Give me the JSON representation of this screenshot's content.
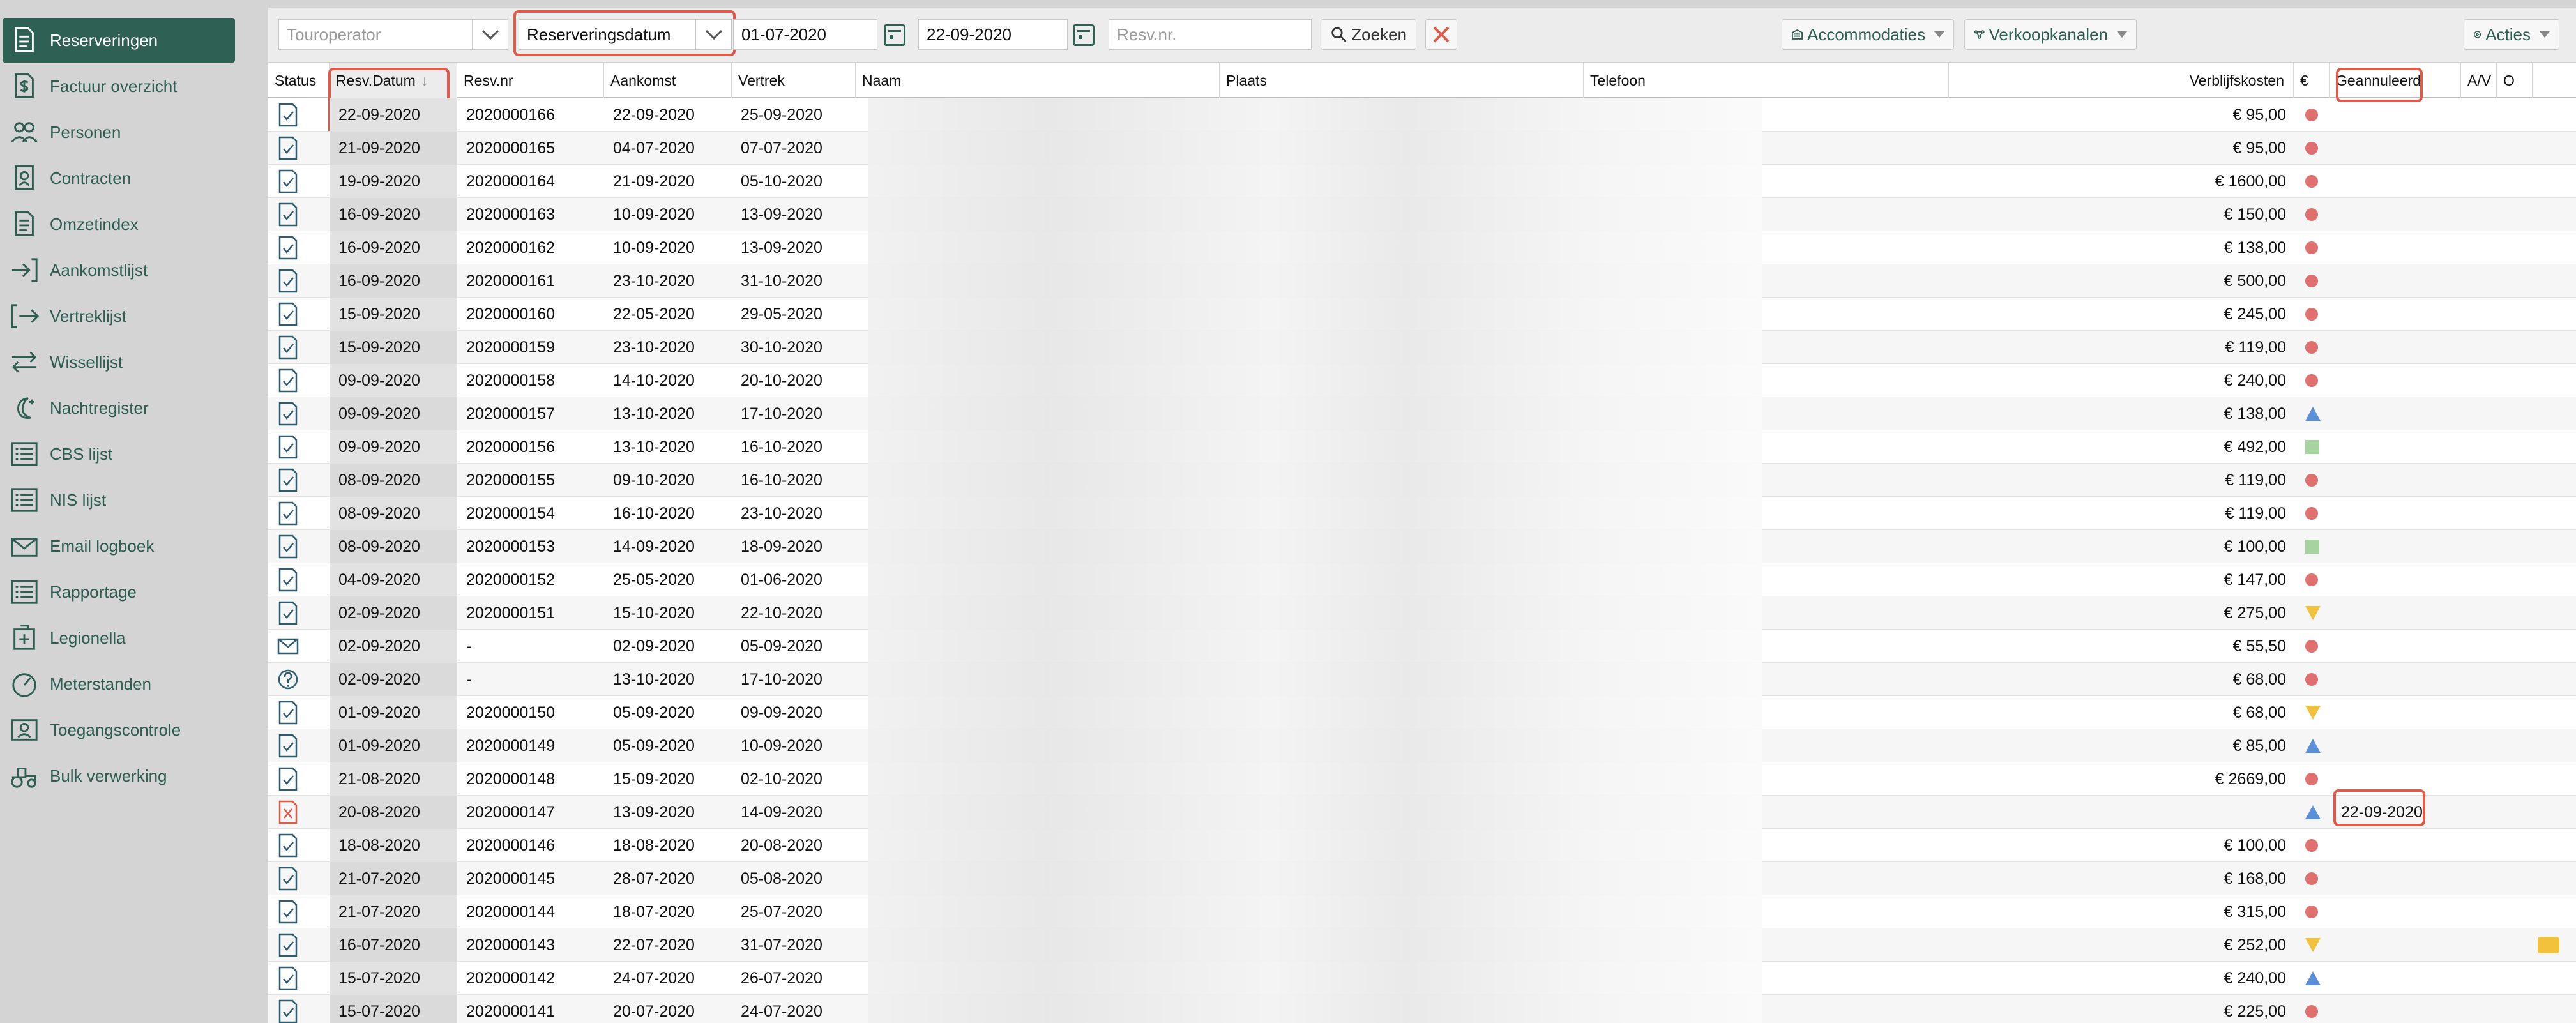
{
  "sidebar": {
    "items": [
      {
        "label": "Reserveringen",
        "icon": "document-icon",
        "active": true
      },
      {
        "label": "Factuur overzicht",
        "icon": "invoice-icon"
      },
      {
        "label": "Personen",
        "icon": "people-icon"
      },
      {
        "label": "Contracten",
        "icon": "contract-icon"
      },
      {
        "label": "Omzetindex",
        "icon": "document-icon"
      },
      {
        "label": "Aankomstlijst",
        "icon": "arrival-icon"
      },
      {
        "label": "Vertreklijst",
        "icon": "departure-icon"
      },
      {
        "label": "Wissellijst",
        "icon": "swap-icon"
      },
      {
        "label": "Nachtregister",
        "icon": "moon-icon"
      },
      {
        "label": "CBS lijst",
        "icon": "list-icon"
      },
      {
        "label": "NIS lijst",
        "icon": "list-icon"
      },
      {
        "label": "Email logboek",
        "icon": "email-icon"
      },
      {
        "label": "Rapportage",
        "icon": "list-icon"
      },
      {
        "label": "Legionella",
        "icon": "medical-icon"
      },
      {
        "label": "Meterstanden",
        "icon": "gauge-icon"
      },
      {
        "label": "Toegangscontrole",
        "icon": "access-icon"
      },
      {
        "label": "Bulk verwerking",
        "icon": "tractor-icon"
      }
    ]
  },
  "toolbar": {
    "touroperator_placeholder": "Touroperator",
    "date_type": "Reserveringsdatum",
    "date_from": "01-07-2020",
    "date_to": "22-09-2020",
    "resv_placeholder": "Resv.nr.",
    "search_label": "Zoeken",
    "accommodaties_label": "Accommodaties",
    "verkoopkanalen_label": "Verkoopkanalen",
    "acties_label": "Acties"
  },
  "columns": {
    "status": "Status",
    "resv_datum": "Resv.Datum",
    "resv_nr": "Resv.nr",
    "aankomst": "Aankomst",
    "vertrek": "Vertrek",
    "naam": "Naam",
    "plaats": "Plaats",
    "telefoon": "Telefoon",
    "verblijfskosten": "Verblijfskosten",
    "euro": "€",
    "geannuleerd": "Geannuleerd",
    "av": "A/V",
    "o": "O"
  },
  "rows": [
    {
      "status": "check",
      "resv_datum": "22-09-2020",
      "resv_nr": "2020000166",
      "aankomst": "22-09-2020",
      "vertrek": "25-09-2020",
      "kosten": "€ 95,00",
      "pay": "dot",
      "geannuleerd": ""
    },
    {
      "status": "check",
      "resv_datum": "21-09-2020",
      "resv_nr": "2020000165",
      "aankomst": "04-07-2020",
      "vertrek": "07-07-2020",
      "kosten": "€ 95,00",
      "pay": "dot",
      "geannuleerd": ""
    },
    {
      "status": "check",
      "resv_datum": "19-09-2020",
      "resv_nr": "2020000164",
      "aankomst": "21-09-2020",
      "vertrek": "05-10-2020",
      "kosten": "€ 1600,00",
      "pay": "dot",
      "geannuleerd": ""
    },
    {
      "status": "check",
      "resv_datum": "16-09-2020",
      "resv_nr": "2020000163",
      "aankomst": "10-09-2020",
      "vertrek": "13-09-2020",
      "kosten": "€ 150,00",
      "pay": "dot",
      "geannuleerd": ""
    },
    {
      "status": "check",
      "resv_datum": "16-09-2020",
      "resv_nr": "2020000162",
      "aankomst": "10-09-2020",
      "vertrek": "13-09-2020",
      "kosten": "€ 138,00",
      "pay": "dot",
      "geannuleerd": ""
    },
    {
      "status": "check",
      "resv_datum": "16-09-2020",
      "resv_nr": "2020000161",
      "aankomst": "23-10-2020",
      "vertrek": "31-10-2020",
      "kosten": "€ 500,00",
      "pay": "dot",
      "geannuleerd": ""
    },
    {
      "status": "check",
      "resv_datum": "15-09-2020",
      "resv_nr": "2020000160",
      "aankomst": "22-05-2020",
      "vertrek": "29-05-2020",
      "kosten": "€ 245,00",
      "pay": "dot",
      "geannuleerd": ""
    },
    {
      "status": "check",
      "resv_datum": "15-09-2020",
      "resv_nr": "2020000159",
      "aankomst": "23-10-2020",
      "vertrek": "30-10-2020",
      "kosten": "€ 119,00",
      "pay": "dot",
      "geannuleerd": ""
    },
    {
      "status": "check",
      "resv_datum": "09-09-2020",
      "resv_nr": "2020000158",
      "aankomst": "14-10-2020",
      "vertrek": "20-10-2020",
      "kosten": "€ 240,00",
      "pay": "dot",
      "geannuleerd": ""
    },
    {
      "status": "check",
      "resv_datum": "09-09-2020",
      "resv_nr": "2020000157",
      "aankomst": "13-10-2020",
      "vertrek": "17-10-2020",
      "kosten": "€ 138,00",
      "pay": "tri-up",
      "geannuleerd": ""
    },
    {
      "status": "check",
      "resv_datum": "09-09-2020",
      "resv_nr": "2020000156",
      "aankomst": "13-10-2020",
      "vertrek": "16-10-2020",
      "kosten": "€ 492,00",
      "pay": "sq",
      "geannuleerd": ""
    },
    {
      "status": "check",
      "resv_datum": "08-09-2020",
      "resv_nr": "2020000155",
      "aankomst": "09-10-2020",
      "vertrek": "16-10-2020",
      "kosten": "€ 119,00",
      "pay": "dot",
      "geannuleerd": ""
    },
    {
      "status": "check",
      "resv_datum": "08-09-2020",
      "resv_nr": "2020000154",
      "aankomst": "16-10-2020",
      "vertrek": "23-10-2020",
      "kosten": "€ 119,00",
      "pay": "dot",
      "geannuleerd": ""
    },
    {
      "status": "check",
      "resv_datum": "08-09-2020",
      "resv_nr": "2020000153",
      "aankomst": "14-09-2020",
      "vertrek": "18-09-2020",
      "kosten": "€ 100,00",
      "pay": "sq",
      "geannuleerd": ""
    },
    {
      "status": "check",
      "resv_datum": "04-09-2020",
      "resv_nr": "2020000152",
      "aankomst": "25-05-2020",
      "vertrek": "01-06-2020",
      "kosten": "€ 147,00",
      "pay": "dot",
      "geannuleerd": ""
    },
    {
      "status": "check",
      "resv_datum": "02-09-2020",
      "resv_nr": "2020000151",
      "aankomst": "15-10-2020",
      "vertrek": "22-10-2020",
      "kosten": "€ 275,00",
      "pay": "tri-down",
      "geannuleerd": ""
    },
    {
      "status": "mail",
      "resv_datum": "02-09-2020",
      "resv_nr": "-",
      "aankomst": "02-09-2020",
      "vertrek": "05-09-2020",
      "kosten": "€ 55,50",
      "pay": "dot",
      "geannuleerd": ""
    },
    {
      "status": "question",
      "resv_datum": "02-09-2020",
      "resv_nr": "-",
      "aankomst": "13-10-2020",
      "vertrek": "17-10-2020",
      "kosten": "€ 68,00",
      "pay": "dot",
      "geannuleerd": ""
    },
    {
      "status": "check",
      "resv_datum": "01-09-2020",
      "resv_nr": "2020000150",
      "aankomst": "05-09-2020",
      "vertrek": "09-09-2020",
      "kosten": "€ 68,00",
      "pay": "tri-down",
      "geannuleerd": ""
    },
    {
      "status": "check",
      "resv_datum": "01-09-2020",
      "resv_nr": "2020000149",
      "aankomst": "05-09-2020",
      "vertrek": "10-09-2020",
      "kosten": "€ 85,00",
      "pay": "tri-up",
      "geannuleerd": ""
    },
    {
      "status": "check",
      "resv_datum": "21-08-2020",
      "resv_nr": "2020000148",
      "aankomst": "15-09-2020",
      "vertrek": "02-10-2020",
      "kosten": "€ 2669,00",
      "pay": "dot",
      "geannuleerd": ""
    },
    {
      "status": "cancel",
      "resv_datum": "20-08-2020",
      "resv_nr": "2020000147",
      "aankomst": "13-09-2020",
      "vertrek": "14-09-2020",
      "kosten": "",
      "pay": "tri-up",
      "geannuleerd": "22-09-2020"
    },
    {
      "status": "check",
      "resv_datum": "18-08-2020",
      "resv_nr": "2020000146",
      "aankomst": "18-08-2020",
      "vertrek": "20-08-2020",
      "kosten": "€ 100,00",
      "pay": "dot",
      "geannuleerd": ""
    },
    {
      "status": "check",
      "resv_datum": "21-07-2020",
      "resv_nr": "2020000145",
      "aankomst": "28-07-2020",
      "vertrek": "05-08-2020",
      "kosten": "€ 168,00",
      "pay": "dot",
      "geannuleerd": ""
    },
    {
      "status": "check",
      "resv_datum": "21-07-2020",
      "resv_nr": "2020000144",
      "aankomst": "18-07-2020",
      "vertrek": "25-07-2020",
      "kosten": "€ 315,00",
      "pay": "dot",
      "geannuleerd": ""
    },
    {
      "status": "check",
      "resv_datum": "16-07-2020",
      "resv_nr": "2020000143",
      "aankomst": "22-07-2020",
      "vertrek": "31-07-2020",
      "kosten": "€ 252,00",
      "pay": "tri-down",
      "geannuleerd": "",
      "comment": true
    },
    {
      "status": "check",
      "resv_datum": "15-07-2020",
      "resv_nr": "2020000142",
      "aankomst": "24-07-2020",
      "vertrek": "26-07-2020",
      "kosten": "€ 240,00",
      "pay": "tri-up",
      "geannuleerd": ""
    },
    {
      "status": "check",
      "resv_datum": "15-07-2020",
      "resv_nr": "2020000141",
      "aankomst": "20-07-2020",
      "vertrek": "24-07-2020",
      "kosten": "€ 225,00",
      "pay": "dot",
      "geannuleerd": ""
    }
  ],
  "colors": {
    "accent": "#2e6153",
    "highlight": "#e05a4a",
    "status_red": "#e07070",
    "status_blue": "#5b8fd8",
    "status_yellow": "#f3c23d",
    "status_green": "#a7d3a0"
  }
}
